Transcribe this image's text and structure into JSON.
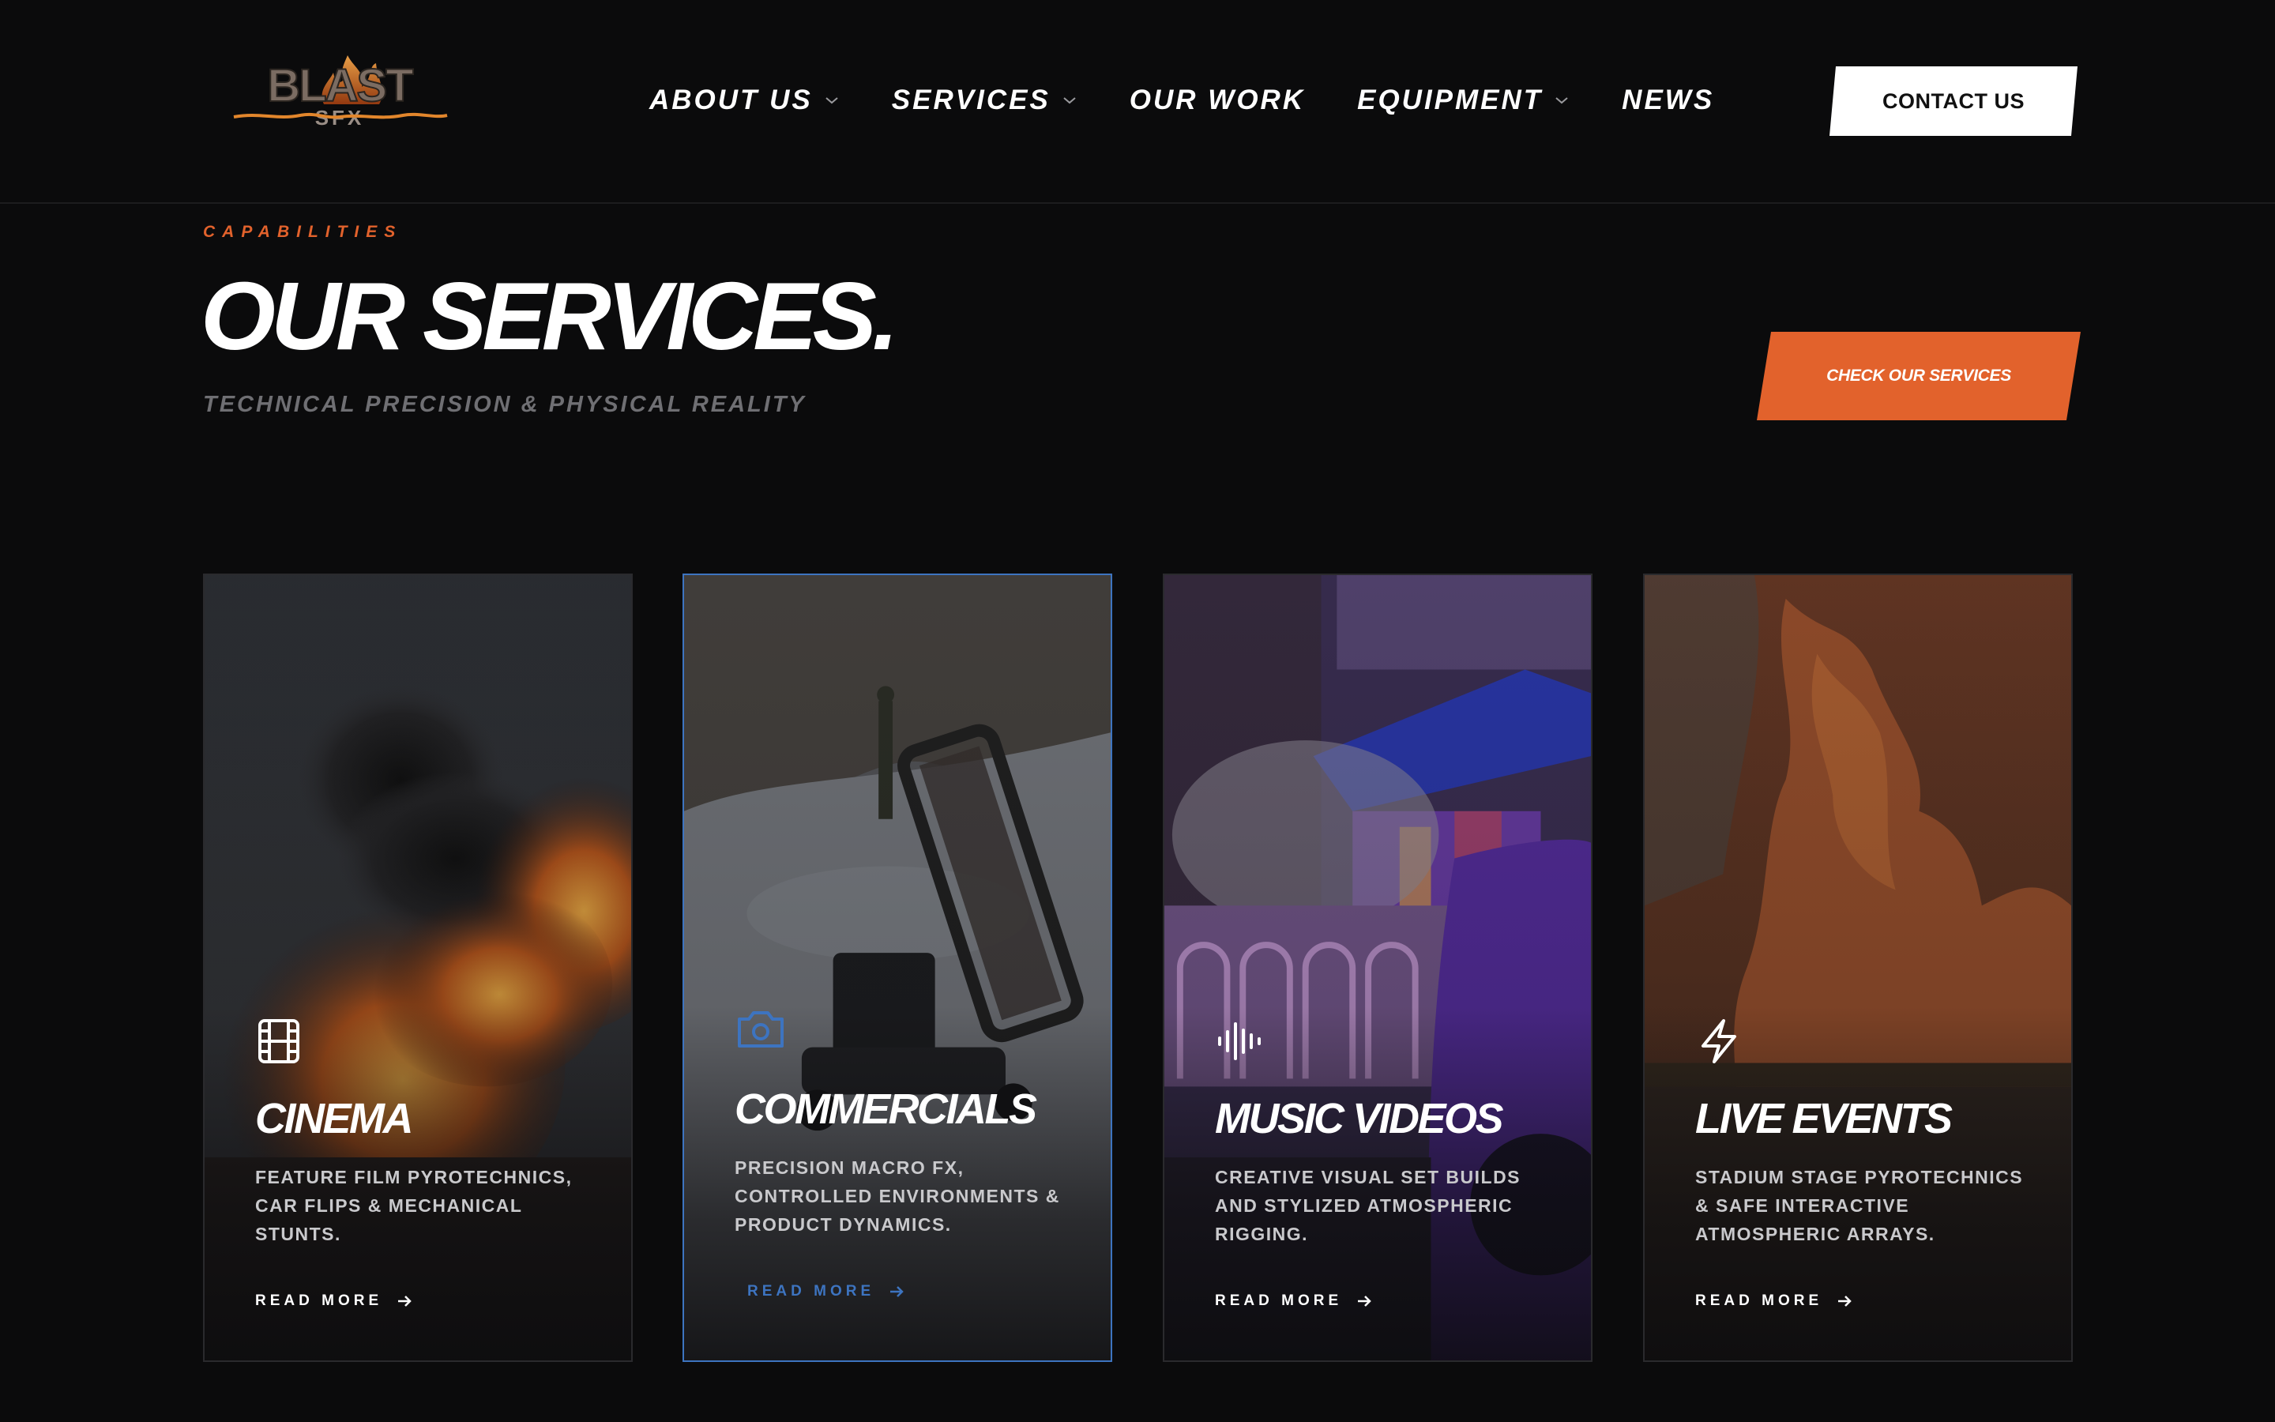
{
  "header": {
    "logo": {
      "text_main": "BLAST",
      "text_sub": "SFX",
      "icon": "flame-logo"
    },
    "nav": [
      {
        "label": "ABOUT US",
        "has_dropdown": true
      },
      {
        "label": "SERVICES",
        "has_dropdown": true
      },
      {
        "label": "OUR WORK",
        "has_dropdown": false
      },
      {
        "label": "EQUIPMENT",
        "has_dropdown": true
      },
      {
        "label": "NEWS",
        "has_dropdown": false
      }
    ],
    "contact_label": "CONTACT US"
  },
  "section": {
    "eyebrow": "CAPABILITIES",
    "title": "OUR SERVICES.",
    "subtitle": "TECHNICAL PRECISION & PHYSICAL REALITY",
    "cta_label": "CHECK OUR SERVICES"
  },
  "cards": [
    {
      "title": "CINEMA",
      "desc": "FEATURE FILM PYROTECHNICS, CAR FLIPS & MECHANICAL STUNTS.",
      "read_more": "READ MORE",
      "icon": "film-icon"
    },
    {
      "title": "COMMERCIALS",
      "desc": "PRECISION MACRO FX, CONTROLLED ENVIRONMENTS & PRODUCT DYNAMICS.",
      "read_more": "READ MORE",
      "icon": "camera-icon"
    },
    {
      "title": "MUSIC VIDEOS",
      "desc": "CREATIVE VISUAL SET BUILDS AND STYLIZED ATMOSPHERIC RIGGING.",
      "read_more": "READ MORE",
      "icon": "audio-wave-icon"
    },
    {
      "title": "LIVE EVENTS",
      "desc": "STADIUM STAGE PYROTECHNICS & SAFE INTERACTIVE ATMOSPHERIC ARRAYS.",
      "read_more": "READ MORE",
      "icon": "lightning-icon"
    }
  ],
  "colors": {
    "background": "#0b0b0c",
    "accent_orange": "#e2622c",
    "active_blue": "#3d74c0",
    "muted_text": "#6f6f73"
  }
}
